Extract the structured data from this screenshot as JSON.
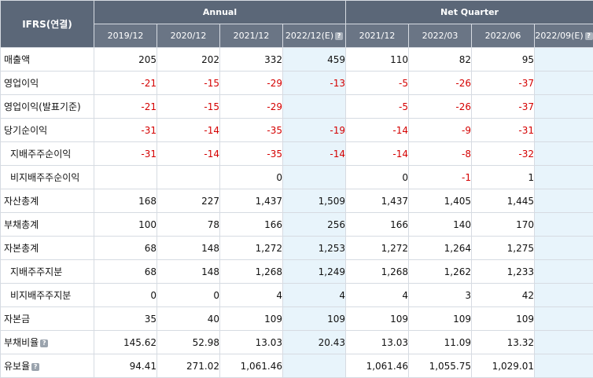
{
  "header": {
    "corner": "IFRS(연결)",
    "annual_label": "Annual",
    "quarter_label": "Net Quarter",
    "periods": [
      "2019/12",
      "2020/12",
      "2021/12",
      "2022/12(E)",
      "2021/12",
      "2022/03",
      "2022/06",
      "2022/09(E)"
    ]
  },
  "rows": [
    {
      "label": "매출액",
      "values": [
        "205",
        "202",
        "332",
        "459",
        "110",
        "82",
        "95",
        ""
      ]
    },
    {
      "label": "영업이익",
      "values": [
        "-21",
        "-15",
        "-29",
        "-13",
        "-5",
        "-26",
        "-37",
        ""
      ]
    },
    {
      "label": "영업이익(발표기준)",
      "values": [
        "-21",
        "-15",
        "-29",
        "",
        "-5",
        "-26",
        "-37",
        ""
      ]
    },
    {
      "label": "당기순이익",
      "values": [
        "-31",
        "-14",
        "-35",
        "-19",
        "-14",
        "-9",
        "-31",
        ""
      ]
    },
    {
      "label": "지배주주순이익",
      "values": [
        "-31",
        "-14",
        "-35",
        "-14",
        "-14",
        "-8",
        "-32",
        ""
      ]
    },
    {
      "label": "비지배주주순이익",
      "values": [
        "",
        "",
        "0",
        "",
        "0",
        "-1",
        "1",
        ""
      ]
    },
    {
      "label": "자산총계",
      "values": [
        "168",
        "227",
        "1,437",
        "1,509",
        "1,437",
        "1,405",
        "1,445",
        ""
      ]
    },
    {
      "label": "부채총계",
      "values": [
        "100",
        "78",
        "166",
        "256",
        "166",
        "140",
        "170",
        ""
      ]
    },
    {
      "label": "자본총계",
      "values": [
        "68",
        "148",
        "1,272",
        "1,253",
        "1,272",
        "1,264",
        "1,275",
        ""
      ]
    },
    {
      "label": "지배주주지분",
      "values": [
        "68",
        "148",
        "1,268",
        "1,249",
        "1,268",
        "1,262",
        "1,233",
        ""
      ]
    },
    {
      "label": "비지배주주지분",
      "values": [
        "0",
        "0",
        "4",
        "4",
        "4",
        "3",
        "42",
        ""
      ]
    },
    {
      "label": "자본금",
      "values": [
        "35",
        "40",
        "109",
        "109",
        "109",
        "109",
        "109",
        ""
      ]
    },
    {
      "label": "부채비율",
      "values": [
        "145.62",
        "52.98",
        "13.03",
        "20.43",
        "13.03",
        "11.09",
        "13.32",
        ""
      ]
    },
    {
      "label": "유보율",
      "values": [
        "94.41",
        "271.02",
        "1,061.46",
        "",
        "1,061.46",
        "1,055.75",
        "1,029.01",
        ""
      ]
    }
  ],
  "colors": {
    "header_bg": "#5b6778",
    "estimate_bg": "#e8f4fb",
    "negative": "#d40000"
  },
  "icons": {
    "help": "question-icon"
  }
}
